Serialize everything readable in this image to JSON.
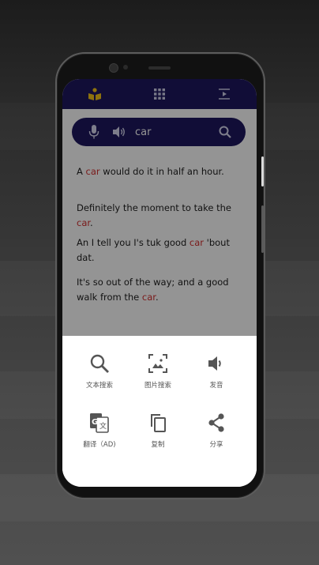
{
  "search": {
    "query": "car",
    "mic_icon": "microphone-icon",
    "speaker_icon": "speaker-icon",
    "search_icon": "search-icon"
  },
  "topbar": {
    "icons": [
      "reader-icon",
      "grid-icon",
      "playlist-icon"
    ]
  },
  "sentences": [
    {
      "pre": "A ",
      "hl": "car",
      "post": " would do it in half an hour."
    },
    {
      "pre": "Definitely the moment to take the ",
      "hl": "car",
      "post": "."
    },
    {
      "pre": "An I tell you I's tuk good ",
      "hl": "car",
      "post": " 'bout dat."
    },
    {
      "pre": "It's so out of the way; and a good walk from the ",
      "hl": "car",
      "post": "."
    }
  ],
  "actions": [
    {
      "label": "文本搜索",
      "icon": "search-icon"
    },
    {
      "label": "图片搜索",
      "icon": "image-search-icon"
    },
    {
      "label": "发音",
      "icon": "volume-icon"
    },
    {
      "label": "翻译（AD)",
      "icon": "translate-icon"
    },
    {
      "label": "复制",
      "icon": "copy-icon"
    },
    {
      "label": "分享",
      "icon": "share-icon"
    }
  ],
  "colors": {
    "accent": "#1e1760",
    "highlight": "#d32f2f",
    "icon_gold": "#f5c518"
  }
}
